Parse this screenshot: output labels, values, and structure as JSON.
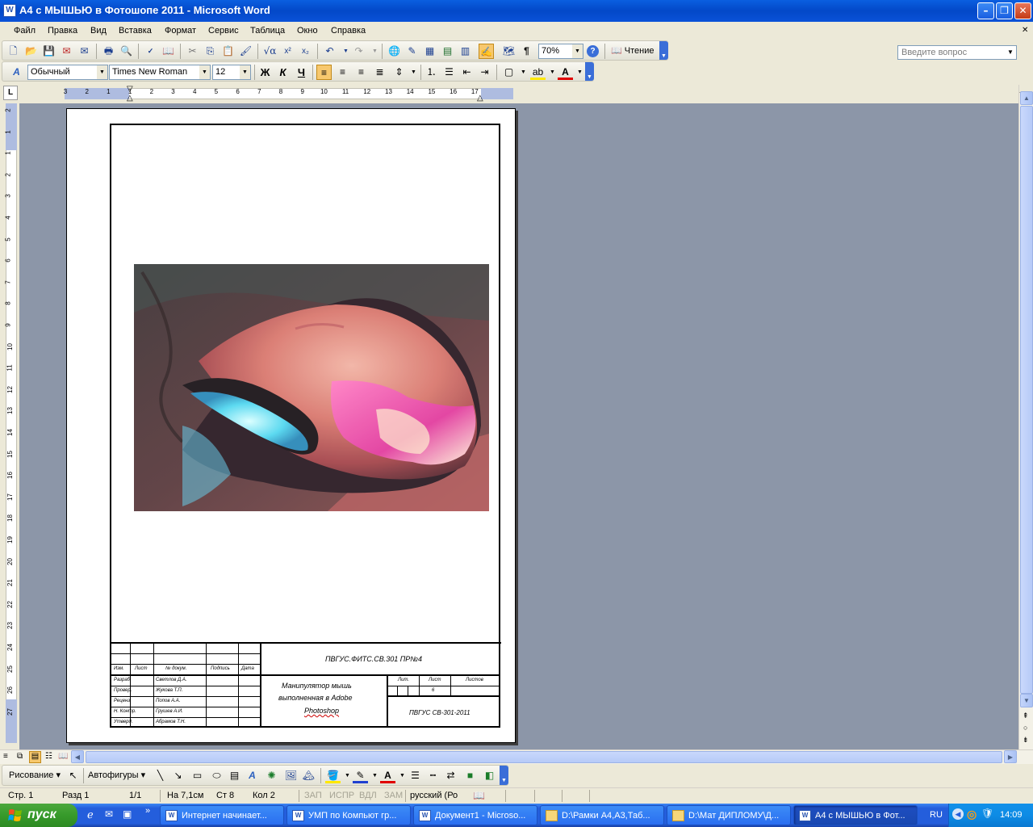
{
  "window": {
    "title": "А4 с МЫШЬЮ в Фотошопе 2011 - Microsoft Word",
    "app_icon": "word-doc-icon"
  },
  "menu": [
    "Файл",
    "Правка",
    "Вид",
    "Вставка",
    "Формат",
    "Сервис",
    "Таблица",
    "Окно",
    "Справка"
  ],
  "help_box": {
    "placeholder": "Введите вопрос"
  },
  "standard_toolbar": {
    "zoom": "70%",
    "reading_label": "Чтение"
  },
  "formatting_toolbar": {
    "style": "Обычный",
    "font": "Times New Roman",
    "size": "12",
    "bold": "Ж",
    "italic": "К",
    "underline": "Ч"
  },
  "ruler": {
    "h_labels": [
      "3",
      "2",
      "1",
      "1",
      "2",
      "3",
      "4",
      "5",
      "6",
      "7",
      "8",
      "9",
      "10",
      "11",
      "12",
      "13",
      "14",
      "15",
      "16",
      "17"
    ],
    "v_labels": [
      "2",
      "1",
      "1",
      "2",
      "3",
      "4",
      "5",
      "6",
      "7",
      "8",
      "9",
      "10",
      "11",
      "12",
      "13",
      "14",
      "15",
      "16",
      "17",
      "18",
      "19",
      "20",
      "21",
      "22",
      "23",
      "24",
      "25",
      "26",
      "27"
    ]
  },
  "stamp": {
    "designation": "ПВГУС.ФИТС.СВ.301 ПР№4",
    "col_headers": [
      "Изм.",
      "Лист",
      "№ докум.",
      "Подпись",
      "Дата"
    ],
    "roles": [
      "Разраб.",
      "Провер.",
      "Реценз.",
      "Н. Контр.",
      "Утверд."
    ],
    "names": [
      "Светлов Д.А.",
      "Жукова Т.П.",
      "Попов А.А.",
      "Грушев А.И.",
      "Абрамов Т.Н."
    ],
    "title_lines": [
      "Манипулятор мышь",
      "выполненная в Adobe",
      "Photoshop"
    ],
    "lit_headers": [
      "Лит.",
      "Лист",
      "Листов"
    ],
    "sheet": "6",
    "org": "ПВГУС СВ-301-2011"
  },
  "drawing_toolbar": {
    "draw_label": "Рисование",
    "autoshapes_label": "Автофигуры"
  },
  "status": {
    "page": "Стр. 1",
    "section": "Разд 1",
    "pages": "1/1",
    "at": "На 7,1см",
    "line": "Ст 8",
    "col": "Кол 2",
    "rec": "ЗАП",
    "trk": "ИСПР",
    "ext": "ВДЛ",
    "ovr": "ЗАМ",
    "lang": "русский (Ро"
  },
  "taskbar": {
    "start_label": "пуск",
    "tasks": [
      "Интернет начинает...",
      "УМП по Компьют гр...",
      "Документ1 - Microso...",
      "D:\\Рамки А4,А3,Таб...",
      "D:\\Мат ДИПЛОМУ\\Д...",
      "А4 с МЫШЬЮ в Фот..."
    ],
    "lang": "RU",
    "time": "14:09"
  },
  "colors": {
    "title_blue": "#0348c8",
    "doc_bg": "#8c96a8",
    "taskbar_blue": "#245edc",
    "start_green": "#379a2b"
  }
}
